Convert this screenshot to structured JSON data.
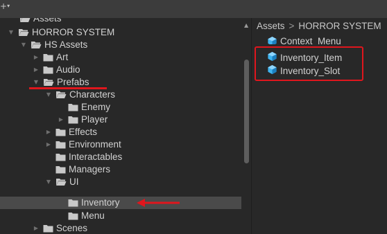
{
  "toolbar": {
    "add_label": "+",
    "add_caret": "▾"
  },
  "tree": {
    "clipped_top": "Assets",
    "rows": [
      {
        "label": "HORROR SYSTEM",
        "expanded": true
      },
      {
        "label": "HS Assets",
        "expanded": true
      },
      {
        "label": "Art",
        "expanded": false
      },
      {
        "label": "Audio",
        "expanded": false
      },
      {
        "label": "Prefabs",
        "expanded": true
      },
      {
        "label": "Characters",
        "expanded": true
      },
      {
        "label": "Enemy"
      },
      {
        "label": "Player",
        "expanded": false
      },
      {
        "label": "Effects",
        "expanded": false
      },
      {
        "label": "Environment",
        "expanded": false
      },
      {
        "label": "Interactables"
      },
      {
        "label": "Managers"
      },
      {
        "label": "UI",
        "expanded": true
      },
      {
        "label": "Inventory",
        "selected": true
      },
      {
        "label": "Menu"
      },
      {
        "label": "Scenes",
        "expanded": false
      }
    ]
  },
  "right_panel": {
    "breadcrumb": [
      "Assets",
      "HORROR SYSTEM"
    ],
    "breadcrumb_sep": ">",
    "assets": [
      "Context_Menu",
      "Inventory_Item",
      "Inventory_Slot"
    ]
  },
  "colors": {
    "background": "#282828",
    "selected_row": "#4a4a4a",
    "highlight_red": "#e0161d",
    "prefab_cube": "#3fb4f0",
    "folder": "#c8c8c8"
  }
}
